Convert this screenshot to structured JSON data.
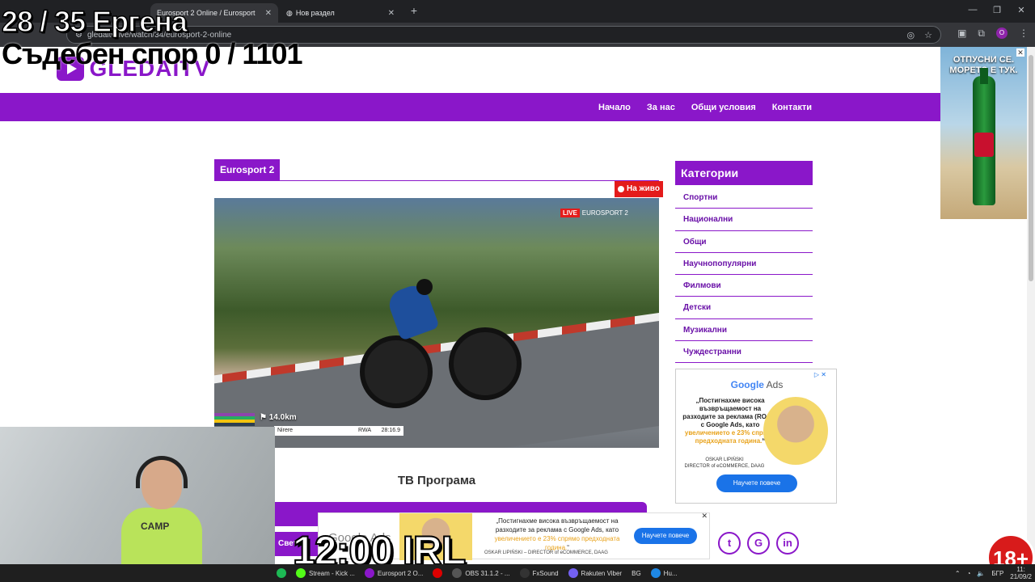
{
  "browser": {
    "tabs": [
      {
        "label": "Eurosport 2 Online / Eurosport",
        "active": true
      },
      {
        "label": "Нов раздел",
        "active": false
      }
    ],
    "url": "gledaitv.live/watch/34/eurosport-2-online",
    "profile_initial": "O"
  },
  "site": {
    "logo_text": "GLEDAITV",
    "nav": [
      "Начало",
      "За нас",
      "Общи условия",
      "Контакти"
    ],
    "channel_title": "Eurosport 2",
    "live_label": "На живо",
    "video": {
      "live_tag": "LIVE",
      "broadcaster": "EUROSPORT 2",
      "distance": "14.0km",
      "rider": "Nirere",
      "country": "RWA",
      "time": "28:16.9"
    },
    "tv_program_heading": "ТВ Програма",
    "tv_bar_label": "Свет",
    "categories_heading": "Категории",
    "categories": [
      "Спортни",
      "Национални",
      "Общи",
      "Научнопопулярни",
      "Филмови",
      "Детски",
      "Музикални",
      "Чуждестранни"
    ],
    "social": [
      "t",
      "G",
      "in"
    ]
  },
  "ads": {
    "side_banner": {
      "text": "ОТПУСНИ СЕ. МОРЕТО Е ТУК.",
      "close": "✕"
    },
    "google_box": {
      "brand_google": "Google",
      "brand_ads": " Ads",
      "quote_start": "„Постигнахме висока възвръщаемост на разходите за реклама (ROAS) с Google Ads, като ",
      "quote_highlight": "увеличението е 23% спрямо предходната година.",
      "quote_end": "“",
      "person_name": "OSKAR LIPIŃSKI",
      "person_role": "DIRECTOR of eCOMMERCE, DAAG",
      "button": "Научете повече",
      "adchoice": "▷ ✕"
    },
    "bottom_banner": {
      "brand": "Google Ads",
      "text_start": "„Постигнахме висока възвръщаемост на разходите за реклама с Google Ads, като ",
      "text_highlight": "увеличението е 23% спрямо предходната година.",
      "text_end": "“",
      "person": "OSKAR LIPIŃSKI – DIRECTOR of eCOMMERCE, DAAG",
      "button": "Научете повече",
      "close": "✕"
    }
  },
  "stream_overlay": {
    "counter_line1": "28 / 35 Ергена",
    "counter_line2": "Съдебен спор 0 / 1101",
    "irl_label": "12:00 IRL",
    "age_badge": "18+",
    "shirt_text": "CAMP"
  },
  "taskbar": {
    "items": [
      "Stream - Kick ...",
      "Eurosport 2 O...",
      "OBS 31.1.2 - ...",
      "FxSound",
      "Rakuten Viber",
      "BG",
      "Hu..."
    ],
    "language": "БГР",
    "clock": "11:",
    "date": "21/09/2"
  }
}
